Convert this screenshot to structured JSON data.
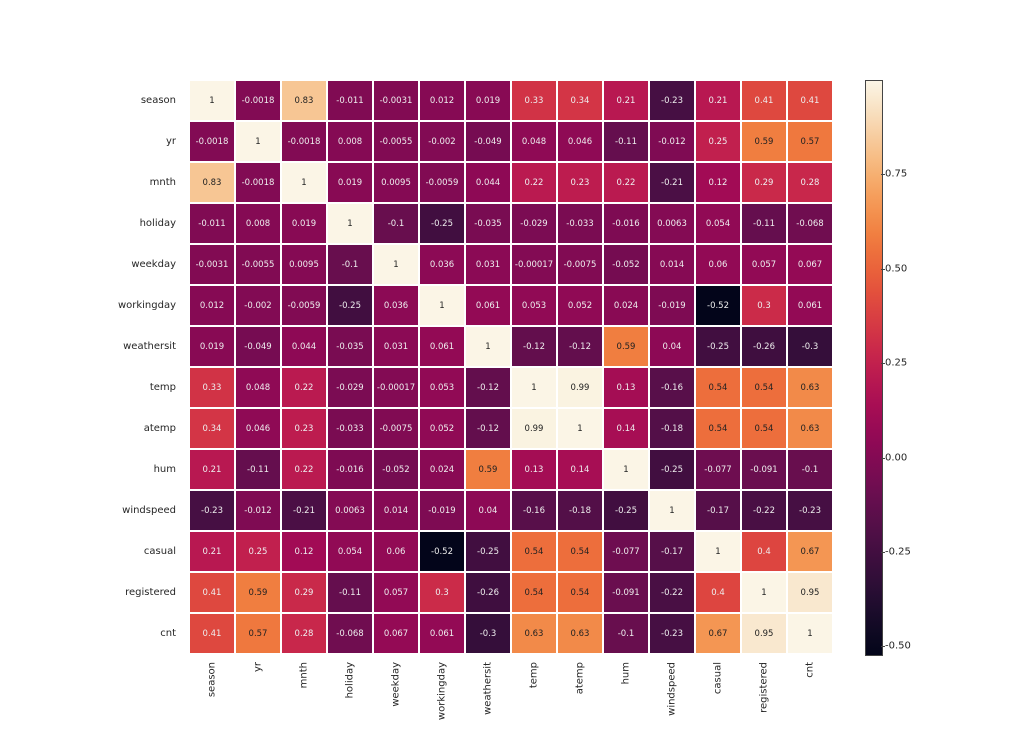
{
  "chart_data": {
    "type": "heatmap",
    "labels": [
      "season",
      "yr",
      "mnth",
      "holiday",
      "weekday",
      "workingday",
      "weathersit",
      "temp",
      "atemp",
      "hum",
      "windspeed",
      "casual",
      "registered",
      "cnt"
    ],
    "matrix": [
      [
        1,
        -0.0018,
        0.83,
        -0.011,
        -0.0031,
        0.012,
        0.019,
        0.33,
        0.34,
        0.21,
        -0.23,
        0.21,
        0.41,
        0.41
      ],
      [
        -0.0018,
        1,
        -0.0018,
        0.008,
        -0.0055,
        -0.002,
        -0.049,
        0.048,
        0.046,
        -0.11,
        -0.012,
        0.25,
        0.59,
        0.57
      ],
      [
        0.83,
        -0.0018,
        1,
        0.019,
        0.0095,
        -0.0059,
        0.044,
        0.22,
        0.23,
        0.22,
        -0.21,
        0.12,
        0.29,
        0.28
      ],
      [
        -0.011,
        0.008,
        0.019,
        1,
        -0.1,
        -0.25,
        -0.035,
        -0.029,
        -0.033,
        -0.016,
        0.0063,
        0.054,
        -0.11,
        -0.068
      ],
      [
        -0.0031,
        -0.0055,
        0.0095,
        -0.1,
        1,
        0.036,
        0.031,
        -0.00017,
        -0.0075,
        -0.052,
        0.014,
        0.06,
        0.057,
        0.067
      ],
      [
        0.012,
        -0.002,
        -0.0059,
        -0.25,
        0.036,
        1,
        0.061,
        0.053,
        0.052,
        0.024,
        -0.019,
        -0.52,
        0.3,
        0.061
      ],
      [
        0.019,
        -0.049,
        0.044,
        -0.035,
        0.031,
        0.061,
        1,
        -0.12,
        -0.12,
        0.59,
        0.04,
        -0.25,
        -0.26,
        -0.3
      ],
      [
        0.33,
        0.048,
        0.22,
        -0.029,
        -0.00017,
        0.053,
        -0.12,
        1,
        0.99,
        0.13,
        -0.16,
        0.54,
        0.54,
        0.63
      ],
      [
        0.34,
        0.046,
        0.23,
        -0.033,
        -0.0075,
        0.052,
        -0.12,
        0.99,
        1,
        0.14,
        -0.18,
        0.54,
        0.54,
        0.63
      ],
      [
        0.21,
        -0.11,
        0.22,
        -0.016,
        -0.052,
        0.024,
        0.59,
        0.13,
        0.14,
        1,
        -0.25,
        -0.077,
        -0.091,
        -0.1
      ],
      [
        -0.23,
        -0.012,
        -0.21,
        0.0063,
        0.014,
        -0.019,
        0.04,
        -0.16,
        -0.18,
        -0.25,
        1,
        -0.17,
        -0.22,
        -0.23
      ],
      [
        0.21,
        0.25,
        0.12,
        0.054,
        0.06,
        -0.52,
        -0.25,
        0.54,
        0.54,
        -0.077,
        -0.17,
        1,
        0.4,
        0.67
      ],
      [
        0.41,
        0.59,
        0.29,
        -0.11,
        0.057,
        0.3,
        -0.26,
        0.54,
        0.54,
        -0.091,
        -0.22,
        0.4,
        1,
        0.95
      ],
      [
        0.41,
        0.57,
        0.28,
        -0.068,
        0.067,
        0.061,
        -0.3,
        0.63,
        0.63,
        -0.1,
        -0.23,
        0.67,
        0.95,
        1
      ]
    ],
    "colorbar_ticks": [
      -0.5,
      -0.25,
      0.0,
      0.25,
      0.5,
      0.75
    ],
    "vmin": -0.52,
    "vmax": 1.0,
    "cmap": "rocket"
  }
}
